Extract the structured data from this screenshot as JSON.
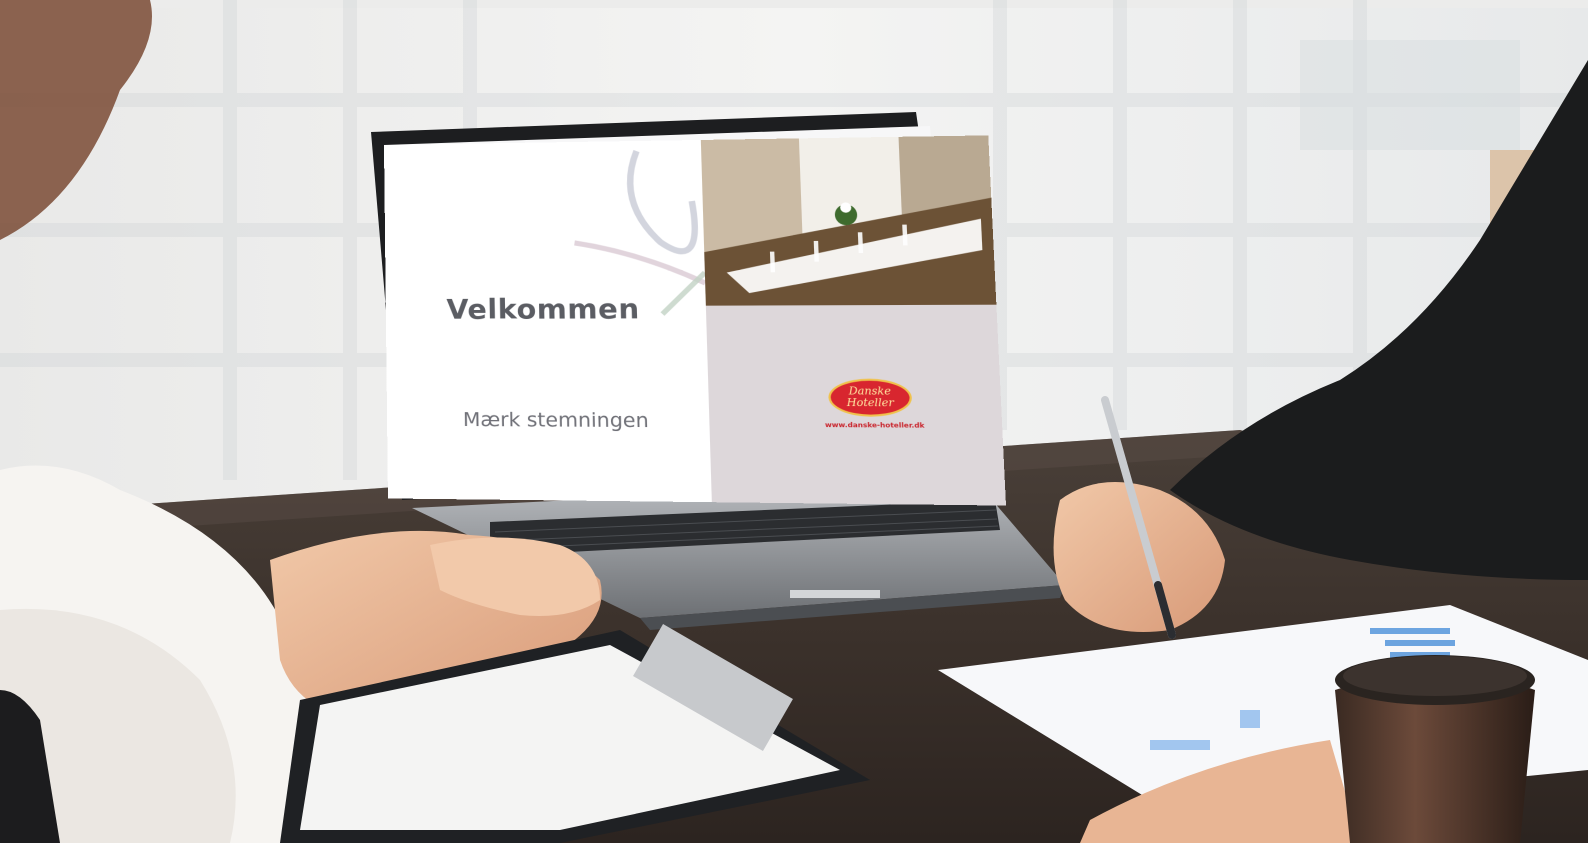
{
  "slide": {
    "title": "Velkommen",
    "subtitle": "Mærk stemningen",
    "logo_line1": "Danske",
    "logo_line2": "Hoteller",
    "logo_url": "www.danske-hoteller.dk"
  },
  "colors": {
    "logo_red": "#d8262f",
    "logo_gold": "#f0c24c",
    "slide_panel": "#ddd7da",
    "title_gray": "#5b5d63"
  }
}
